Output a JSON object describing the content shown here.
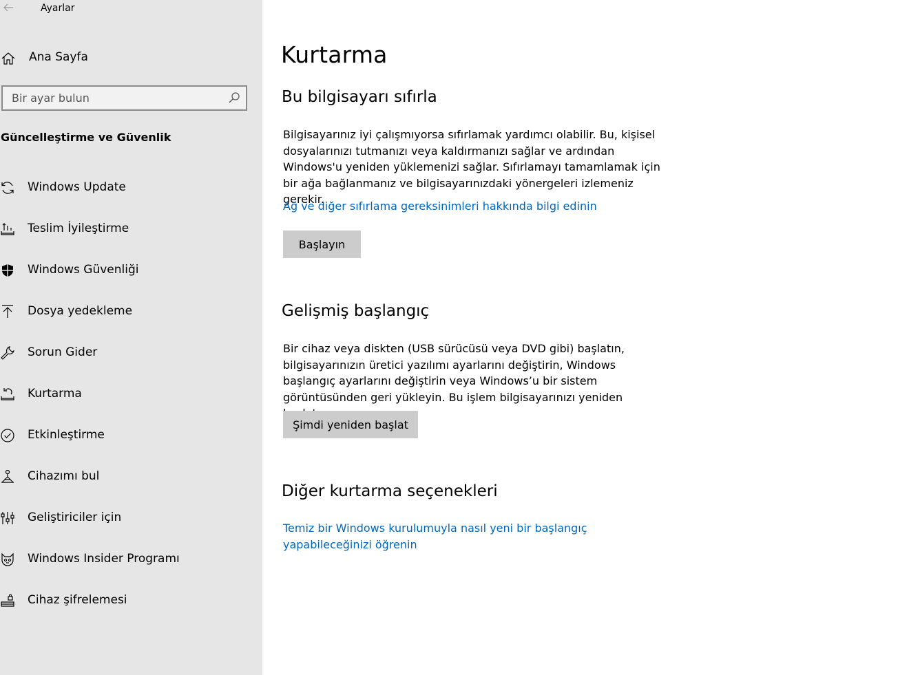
{
  "window": {
    "title": "Ayarlar"
  },
  "sidebar": {
    "home_label": "Ana Sayfa",
    "search": {
      "placeholder": "Bir ayar bulun"
    },
    "section_title": "Güncelleştirme ve Güvenlik",
    "items": [
      {
        "label": "Windows Update",
        "icon": "sync-icon"
      },
      {
        "label": "Teslim İyileştirme",
        "icon": "delivery-optimization-icon"
      },
      {
        "label": "Windows Güvenliği",
        "icon": "shield-icon"
      },
      {
        "label": "Dosya yedekleme",
        "icon": "backup-upload-icon"
      },
      {
        "label": "Sorun Gider",
        "icon": "wrench-icon"
      },
      {
        "label": "Kurtarma",
        "icon": "recovery-icon"
      },
      {
        "label": "Etkinleştirme",
        "icon": "check-circle-icon"
      },
      {
        "label": "Cihazımı bul",
        "icon": "find-device-icon"
      },
      {
        "label": "Geliştiriciler için",
        "icon": "developer-sliders-icon"
      },
      {
        "label": "Windows Insider Programı",
        "icon": "insider-cat-icon"
      },
      {
        "label": "Cihaz şifrelemesi",
        "icon": "drive-encryption-icon"
      }
    ]
  },
  "main": {
    "title": "Kurtarma",
    "reset": {
      "heading": "Bu bilgisayarı sıfırla",
      "description": "Bilgisayarınız iyi çalışmıyorsa sıfırlamak yardımcı olabilir. Bu, kişisel dosyalarınızı tutmanızı veya kaldırmanızı sağlar ve ardından Windows'u yeniden yüklemenizi sağlar. Sıfırlamayı tamamlamak için bir ağa bağlanmanız ve bilgisayarınızdaki yönergeleri izlemeniz gerekir.",
      "link": "Ağ ve diğer sıfırlama gereksinimleri hakkında bilgi edinin",
      "button": "Başlayın"
    },
    "advanced": {
      "heading": "Gelişmiş başlangıç",
      "description": "Bir cihaz veya diskten (USB sürücüsü veya DVD gibi) başlatın, bilgisayarınızın üretici yazılımı ayarlarını değiştirin, Windows başlangıç ayarlarını değiştirin veya Windows’u bir sistem görüntüsünden geri yükleyin. Bu işlem bilgisayarınızı yeniden başlatır.",
      "button": "Şimdi yeniden başlat"
    },
    "other": {
      "heading": "Diğer kurtarma seçenekleri",
      "link": "Temiz bir Windows kurulumuyla nasıl yeni bir başlangıç yapabileceğinizi öğrenin"
    }
  },
  "colors": {
    "sidebar_bg": "#e6e6e6",
    "link": "#0067c0",
    "button_bg": "#cccccc"
  }
}
